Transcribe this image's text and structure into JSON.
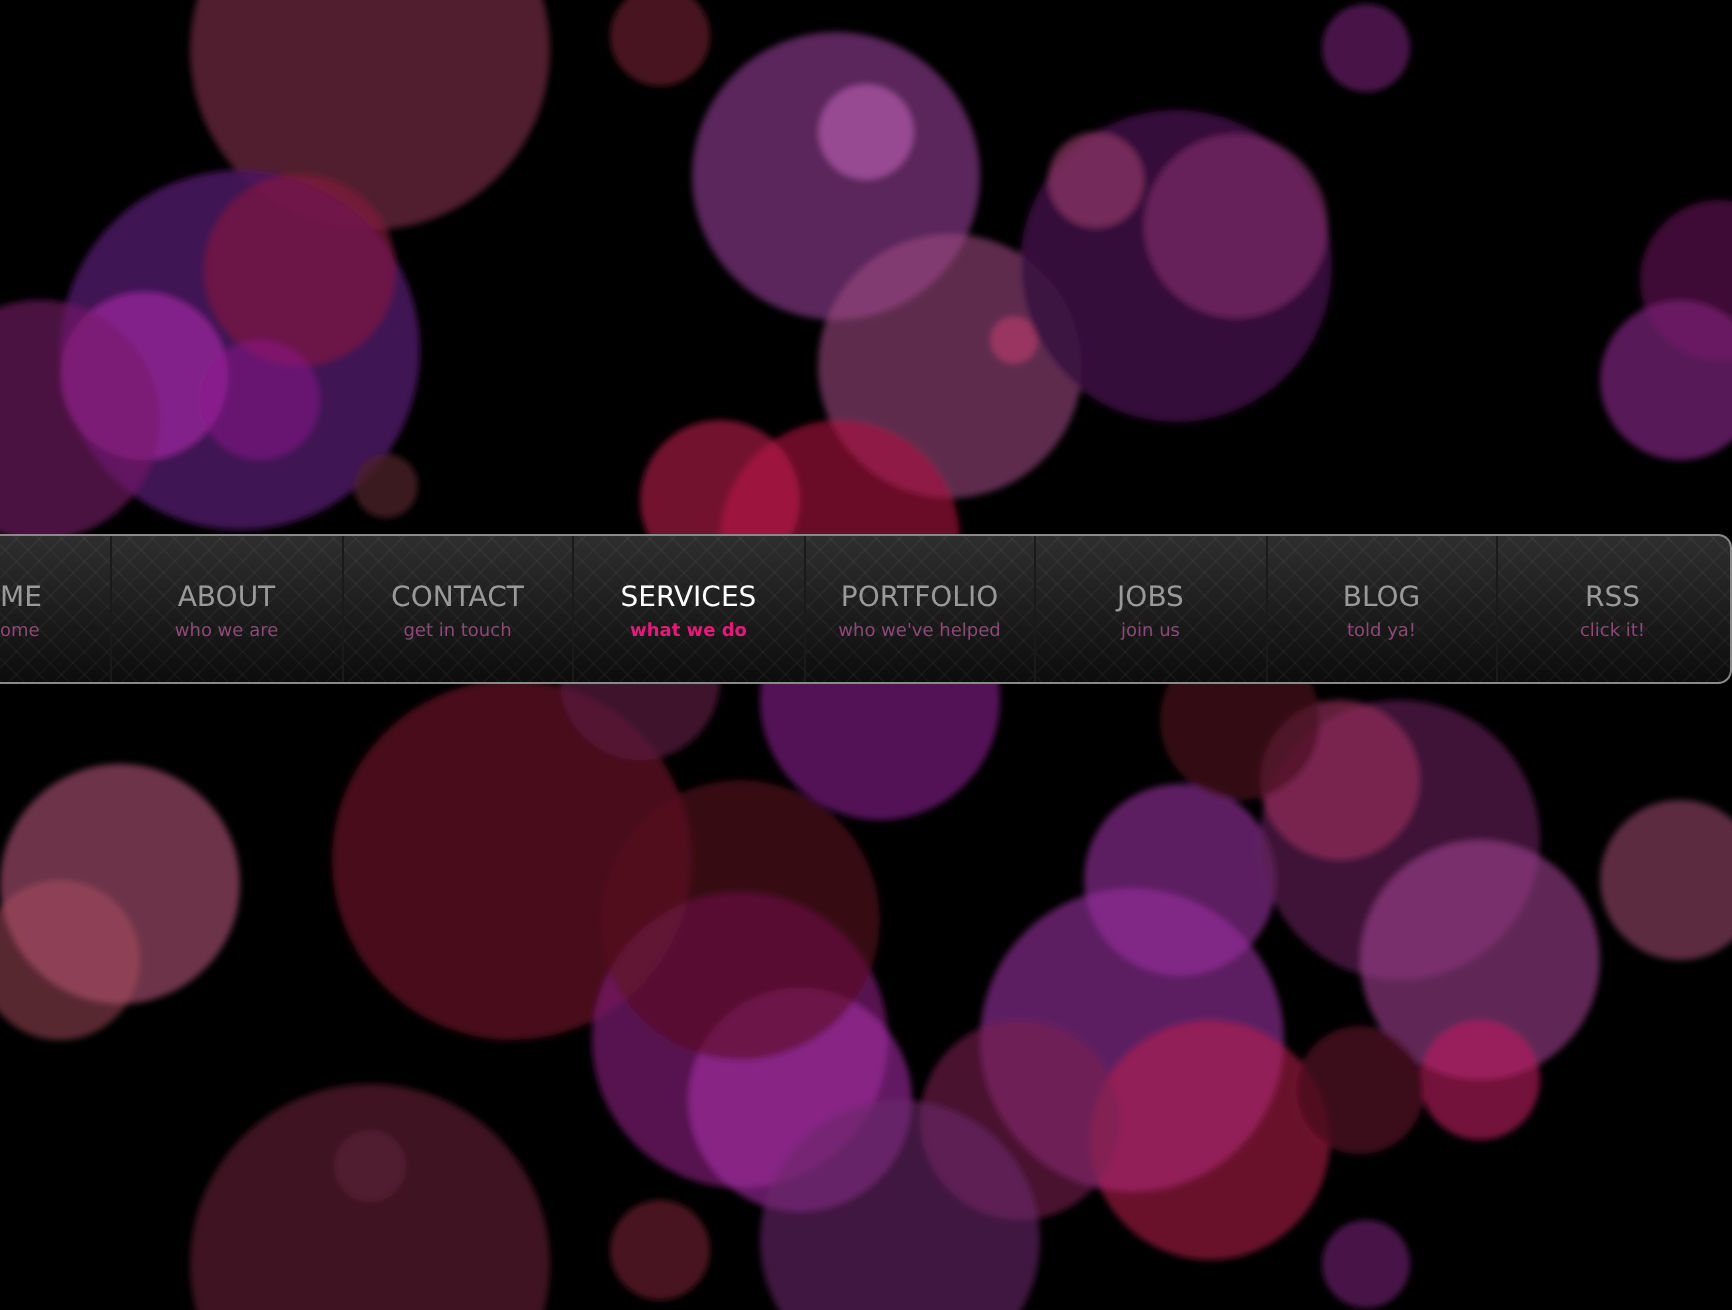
{
  "nav": {
    "items": [
      {
        "label": "ME",
        "caption": "ome",
        "selected": false
      },
      {
        "label": "ABOUT",
        "caption": "who we are",
        "selected": false
      },
      {
        "label": "CONTACT",
        "caption": "get in touch",
        "selected": false
      },
      {
        "label": "SERVICES",
        "caption": "what we do",
        "selected": true
      },
      {
        "label": "PORTFOLIO",
        "caption": "who we've helped",
        "selected": false
      },
      {
        "label": "JOBS",
        "caption": "join us",
        "selected": false
      },
      {
        "label": "BLOG",
        "caption": "told ya!",
        "selected": false
      },
      {
        "label": "RSS",
        "caption": "click it!",
        "selected": false
      }
    ]
  }
}
